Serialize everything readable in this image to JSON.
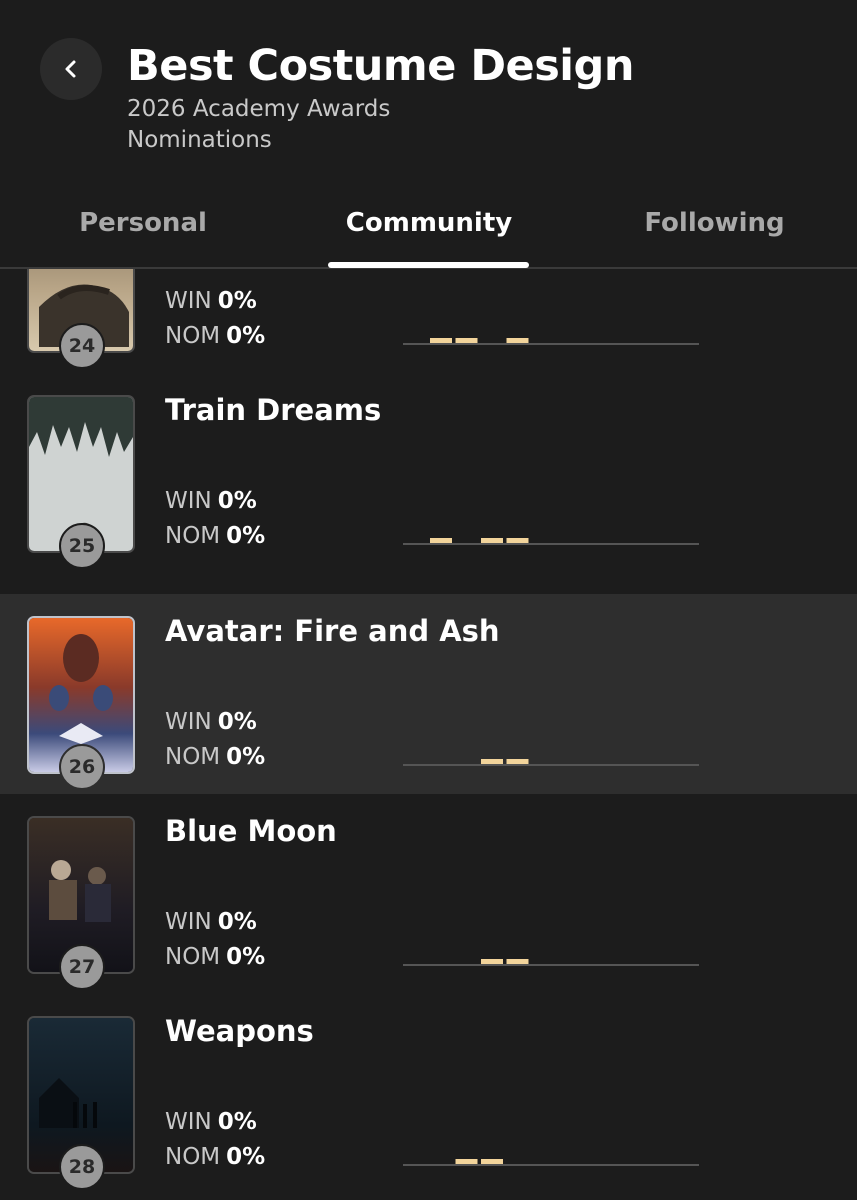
{
  "header": {
    "title": "Best Costume Design",
    "subtitle_line1": "2026 Academy Awards",
    "subtitle_line2": "Nominations",
    "back_icon": "chevron-left-icon"
  },
  "tabs": {
    "personal": "Personal",
    "community": "Community",
    "following": "Following",
    "active": "Community"
  },
  "colors": {
    "background": "#1c1c1c",
    "selected_row": "#2e2e2e",
    "spark_bar": "#f2d49b",
    "baseline": "#555555"
  },
  "stats_labels": {
    "win": "WIN",
    "nom": "NOM"
  },
  "films": [
    {
      "rank": "24",
      "title": "",
      "win": "0%",
      "nom": "0%",
      "selected": false,
      "spark_bins": [
        1,
        2,
        4
      ]
    },
    {
      "rank": "25",
      "title": "Train Dreams",
      "win": "0%",
      "nom": "0%",
      "selected": false,
      "spark_bins": [
        1,
        3,
        4
      ]
    },
    {
      "rank": "26",
      "title": "Avatar: Fire and Ash",
      "win": "0%",
      "nom": "0%",
      "selected": true,
      "spark_bins": [
        3,
        4
      ]
    },
    {
      "rank": "27",
      "title": "Blue Moon",
      "win": "0%",
      "nom": "0%",
      "selected": false,
      "spark_bins": [
        3,
        4
      ]
    },
    {
      "rank": "28",
      "title": "Weapons",
      "win": "0%",
      "nom": "0%",
      "selected": false,
      "spark_bins": [
        2,
        3
      ]
    }
  ]
}
